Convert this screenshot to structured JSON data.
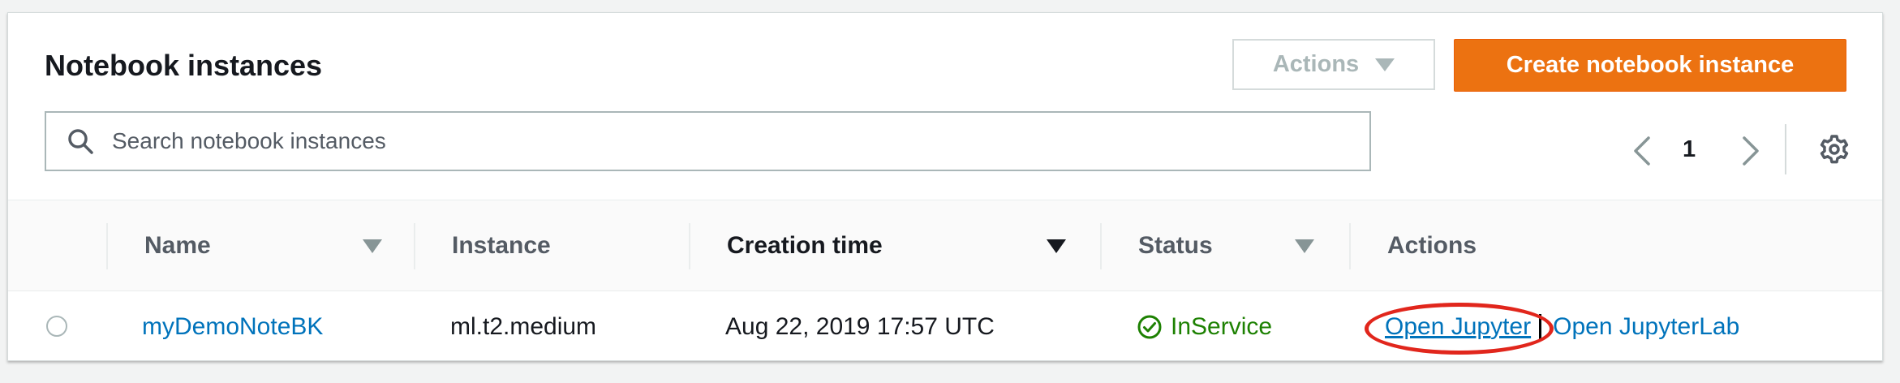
{
  "panel": {
    "title": "Notebook instances",
    "actions_label": "Actions",
    "create_label": "Create notebook instance"
  },
  "search": {
    "placeholder": "Search notebook instances",
    "value": ""
  },
  "pagination": {
    "current_page": "1"
  },
  "table": {
    "columns": [
      "Name",
      "Instance",
      "Creation time",
      "Status",
      "Actions"
    ],
    "rows": [
      {
        "name": "myDemoNoteBK",
        "instance": "ml.t2.medium",
        "creation_time": "Aug 22, 2019 17:57 UTC",
        "status": "InService",
        "action_primary": "Open Jupyter",
        "action_secondary": "Open JupyterLab"
      }
    ]
  },
  "icons": {
    "search": "search-icon",
    "prev": "chevron-left-icon",
    "next": "chevron-right-icon",
    "settings": "gear-icon",
    "status": "check-circle-icon",
    "actions_caret": "caret-down-icon"
  },
  "colors": {
    "accent": "#ec7211",
    "link": "#0073bb",
    "success": "#1d8102",
    "annotation": "#e1261c"
  }
}
